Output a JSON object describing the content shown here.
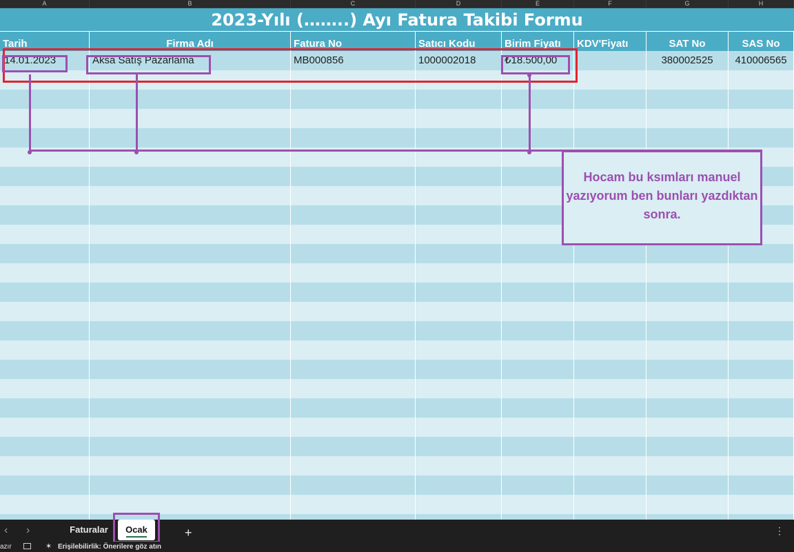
{
  "columns": [
    {
      "letter": "A",
      "header": "Tarih",
      "align": "left"
    },
    {
      "letter": "B",
      "header": "Firma Adı",
      "align": "center"
    },
    {
      "letter": "C",
      "header": "Fatura No",
      "align": "left"
    },
    {
      "letter": "D",
      "header": "Satıcı Kodu",
      "align": "left"
    },
    {
      "letter": "E",
      "header": "Birim Fiyatı",
      "align": "left"
    },
    {
      "letter": "F",
      "header": "KDV'Fiyatı",
      "align": "left"
    },
    {
      "letter": "G",
      "header": "SAT No",
      "align": "center"
    },
    {
      "letter": "H",
      "header": "SAS No",
      "align": "center"
    }
  ],
  "sheet": {
    "title": "2023-Yılı (……..) Ayı Fatura Takibi Formu",
    "rows": [
      [
        "14.01.2023",
        "Aksa Satış Pazarlama",
        "MB000856",
        "1000002018",
        "₺18.500,00",
        "",
        "380002525",
        "410006565"
      ]
    ],
    "empty_rows": 24
  },
  "annotation": {
    "note": "Hocam bu ksımları manuel yazıyorum ben bunları yazdıktan sonra."
  },
  "sheet_tabs": {
    "prev_icon": "‹",
    "next_icon": "›",
    "tabs": [
      "Faturalar",
      "Ocak"
    ],
    "active": "Ocak",
    "add_label": "+",
    "more_icon": "⋮"
  },
  "status": {
    "left_text": "azır",
    "accessibility_text": "Erişilebilirlik: Önerilere göz atın"
  },
  "colors": {
    "header_fill": "#4bacc6",
    "row_fill_a": "#b7dee8",
    "row_fill_b": "#daeef3",
    "highlight_red": "#e3232e",
    "highlight_purple": "#9c4fb0"
  }
}
